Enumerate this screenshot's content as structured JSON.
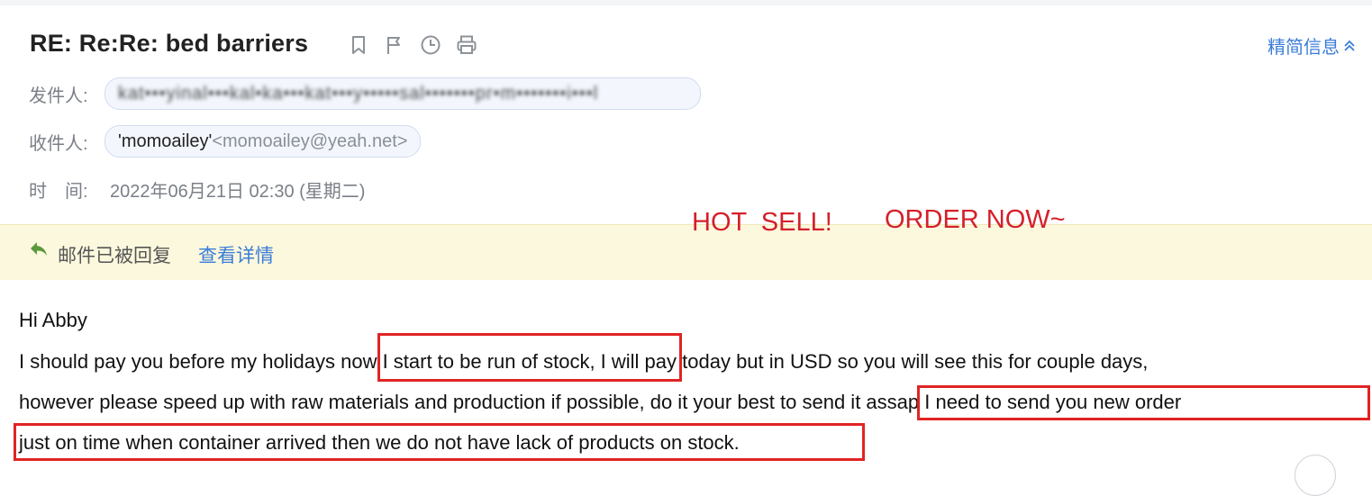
{
  "email": {
    "subject": "RE: Re:Re: bed barriers",
    "simplify_label": "精简信息",
    "sender_label": "发件人:",
    "sender_value": "kat•••yinal•••kal•ka•••kat•••y•••••sal•••••••pr•m•••••••i•••l",
    "recipient_label": "收件人:",
    "recipient_name": "'momoailey'",
    "recipient_addr": "<momoailey@yeah.net>",
    "time_label": "时　间:",
    "time_value": "2022年06月21日 02:30 (星期二)"
  },
  "banner": {
    "reply_status": "邮件已被回复",
    "detail_link": "查看详情"
  },
  "overlay": {
    "hot_sell": "HOT  SELL!",
    "order_now": "ORDER NOW~"
  },
  "body": {
    "greeting": "Hi Abby",
    "line1": "I should pay you before my holidays now I start to be run of stock, I will pay today but in USD so you will see this for couple days,",
    "line2": "however please speed up with raw materials and production if possible, do it your best to send it assap I need to send you new order",
    "line3": "just on time when container arrived then we do not have lack of products on stock."
  },
  "colors": {
    "accent": "#3b7dd8",
    "annotation_red": "#d4202a",
    "banner_bg": "#fcf8dd"
  },
  "icons": [
    "bookmark-icon",
    "flag-icon",
    "clock-icon",
    "print-icon",
    "chevron-up-icon",
    "reply-arrow-icon"
  ]
}
